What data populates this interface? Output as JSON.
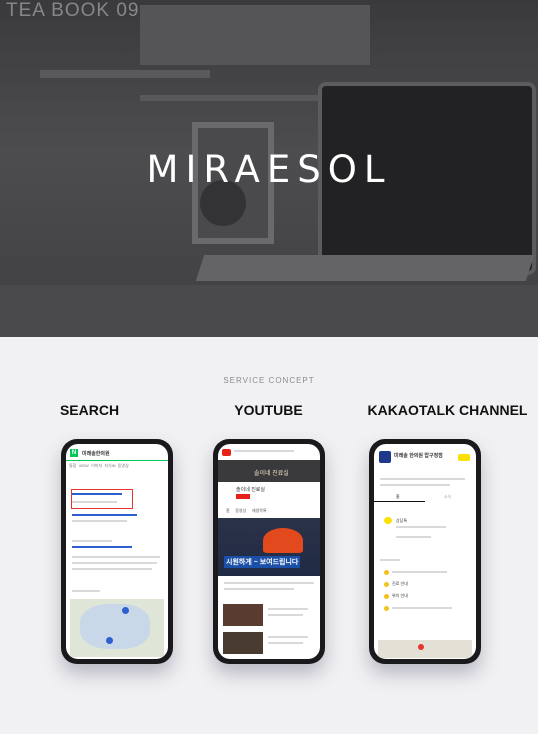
{
  "hero": {
    "title": "MIRAESOL",
    "decor_text": "TEA BOOK 09"
  },
  "concept_label": "SERVICE CONCEPT",
  "services": [
    {
      "title": "SEARCH",
      "screen": {
        "query": "미래솔한의원",
        "tabs": [
          "통합",
          "VIEW",
          "이미지",
          "지식iN",
          "동영상"
        ]
      }
    },
    {
      "title": "YOUTUBE",
      "screen": {
        "channel": "솔이네 진료실",
        "tabs": [
          "홈",
          "동영상",
          "재생목록"
        ],
        "banner": "시원하게 ~ 보여드립니다"
      }
    },
    {
      "title": "KAKAOTALK CHANNEL",
      "screen": {
        "name": "미래솔 한의원 압구정점",
        "tabs": [
          "홈",
          "소식"
        ],
        "items": [
          "상담톡",
          "진료 안내",
          "위치 안내"
        ]
      }
    }
  ],
  "colors": {
    "naver": "#03c75a",
    "youtube": "#e62117",
    "kakao": "#fae100",
    "hero_bg": "#444447"
  }
}
